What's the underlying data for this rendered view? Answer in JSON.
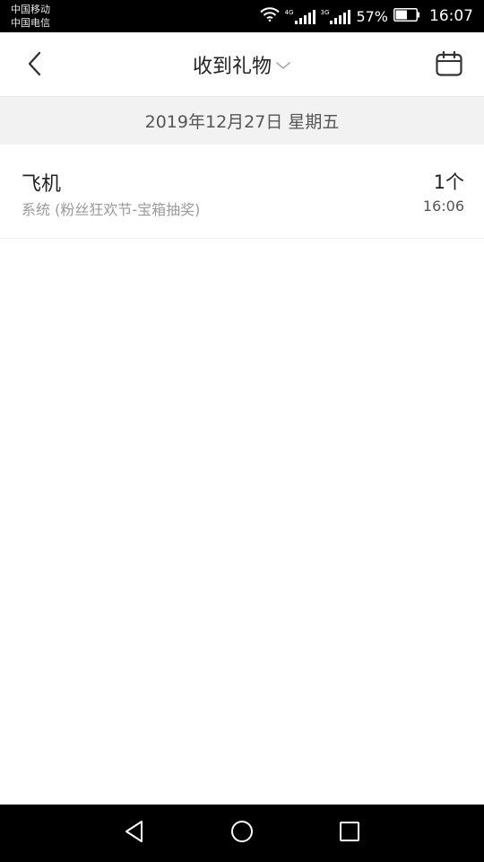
{
  "status_bar": {
    "carrier_1": "中国移动",
    "carrier_2": "中国电信",
    "signal_1_tag": "4G",
    "signal_2_tag": "3G",
    "battery_percent": "57%",
    "battery_level": 0.57,
    "time": "16:07",
    "icons": [
      "wifi-icon",
      "signal-icon",
      "signal-icon",
      "battery-icon"
    ]
  },
  "header": {
    "title": "收到礼物",
    "icons": [
      "back-arrow-icon",
      "chevron-down-icon",
      "calendar-icon"
    ]
  },
  "date_band": {
    "text": "2019年12月27日 星期五"
  },
  "gifts": [
    {
      "name": "飞机",
      "source": "系统 (粉丝狂欢节-宝箱抽奖)",
      "count": "1个",
      "time": "16:06"
    }
  ],
  "nav_bar": {
    "icons": [
      "back-triangle-icon",
      "home-circle-icon",
      "recents-square-icon"
    ]
  },
  "colors": {
    "status_bar_bg": "#000000",
    "date_band_bg": "#f2f2f2",
    "primary_text": "#222222",
    "secondary_text": "#9a9a9a"
  }
}
